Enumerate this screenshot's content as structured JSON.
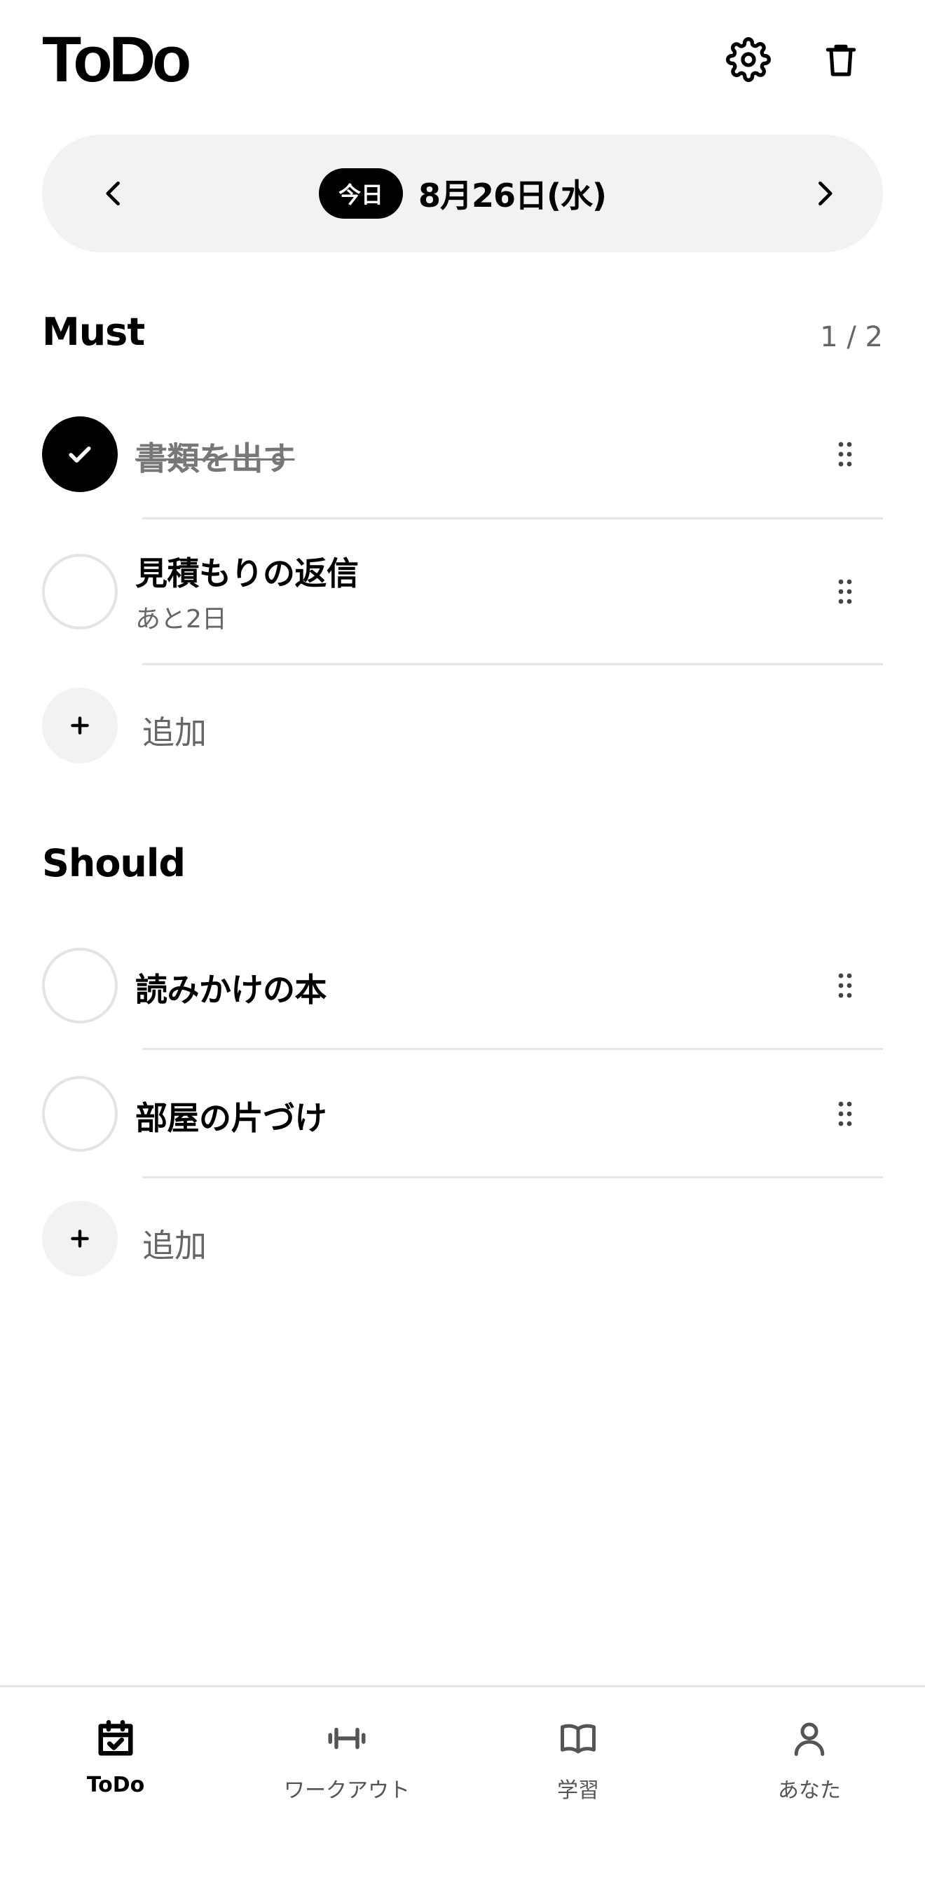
{
  "header": {
    "title": "ToDo",
    "settings_icon": "gear-icon",
    "trash_icon": "trash-icon"
  },
  "date_bar": {
    "today_label": "今日",
    "date": "8月26日(水)",
    "prev_icon": "chevron-left-icon",
    "next_icon": "chevron-right-icon"
  },
  "must": {
    "title": "Must",
    "count": "1 / 2",
    "tasks": [
      {
        "title": "書類を出す",
        "done": true
      },
      {
        "title": "見積もりの返信",
        "subtitle": "あと2日",
        "done": false
      }
    ],
    "add_label": "追加"
  },
  "should": {
    "title": "Should",
    "tasks": [
      {
        "title": "読みかけの本",
        "done": false
      },
      {
        "title": "部屋の片づけ",
        "done": false
      }
    ],
    "add_label": "追加"
  },
  "tabbar": {
    "tabs": [
      {
        "label": "ToDo",
        "icon": "calendar-check-icon",
        "active": true
      },
      {
        "label": "ワークアウト",
        "icon": "dumbbell-icon",
        "active": false
      },
      {
        "label": "学習",
        "icon": "book-icon",
        "active": false
      },
      {
        "label": "あなた",
        "icon": "person-icon",
        "active": false
      }
    ]
  },
  "colors": {
    "accent": "#000000",
    "pill_background": "#f2f2f2",
    "divider": "#e6e6e6",
    "muted_text": "#666666"
  }
}
